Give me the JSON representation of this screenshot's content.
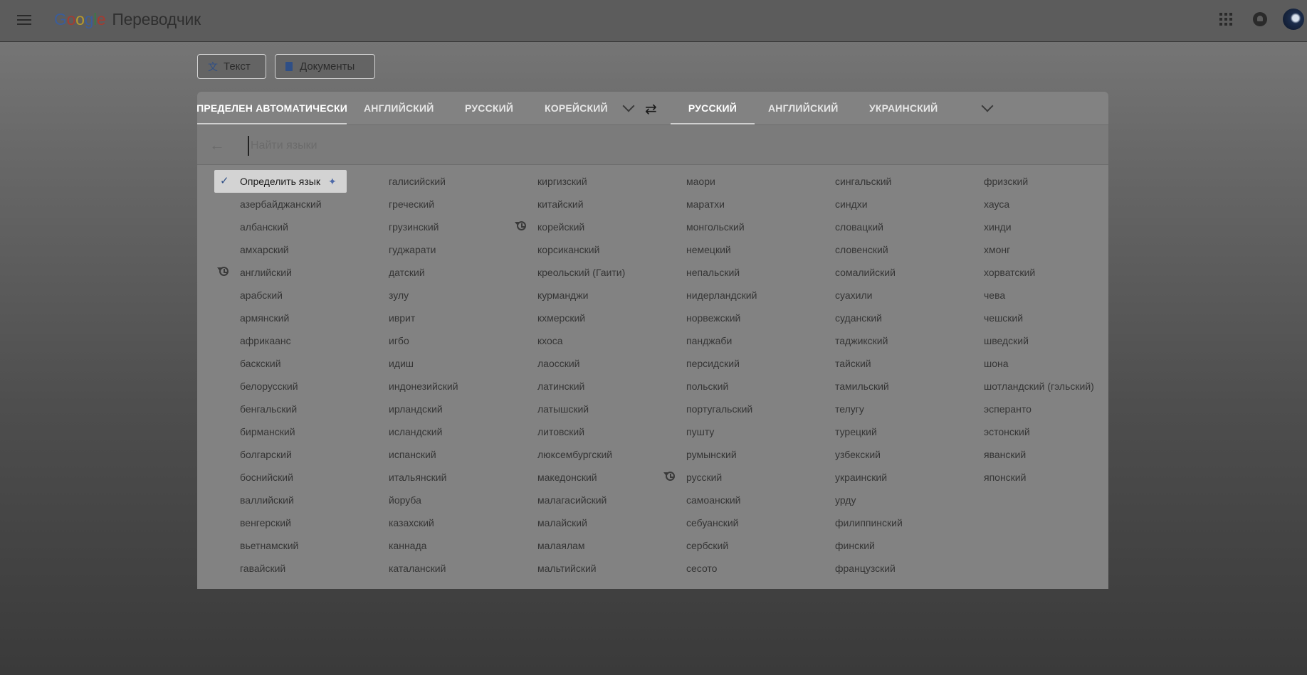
{
  "app": {
    "logo_letters": [
      "G",
      "o",
      "o",
      "g",
      "l",
      "e"
    ],
    "product_name": "Переводчик",
    "menu_icon": "menu-icon",
    "apps_icon": "apps-grid-icon",
    "bell_icon": "notifications-icon",
    "avatar_label": "account-avatar"
  },
  "modes": {
    "text_label": "Текст",
    "docs_label": "Документы"
  },
  "source_tabs": [
    {
      "label": "ОПРЕДЕЛЕН АВТОМАТИЧЕСКИ)",
      "active": true
    },
    {
      "label": "АНГЛИЙСКИЙ",
      "active": false
    },
    {
      "label": "РУССКИЙ",
      "active": false
    },
    {
      "label": "КОРЕЙСКИЙ",
      "active": false
    }
  ],
  "target_tabs": [
    {
      "label": "РУССКИЙ",
      "active": true
    },
    {
      "label": "АНГЛИЙСКИЙ",
      "active": false
    },
    {
      "label": "УКРАИНСКИЙ",
      "active": false
    }
  ],
  "search": {
    "placeholder": "Найти языки",
    "value": ""
  },
  "languages": {
    "col1": [
      "Определить язык",
      "азербайджанский",
      "албанский",
      "амхарский",
      "английский",
      "арабский",
      "армянский",
      "африкаанс",
      "баскский",
      "белорусский",
      "бенгальский",
      "бирманский",
      "болгарский",
      "боснийский",
      "валлийский",
      "венгерский",
      "вьетнамский",
      "гавайский"
    ],
    "col2": [
      "галисийский",
      "греческий",
      "грузинский",
      "гуджарати",
      "датский",
      "зулу",
      "иврит",
      "игбо",
      "идиш",
      "индонезийский",
      "ирландский",
      "исландский",
      "испанский",
      "итальянский",
      "йоруба",
      "казахский",
      "каннада",
      "каталанский"
    ],
    "col3": [
      "киргизский",
      "китайский",
      "корейский",
      "корсиканский",
      "креольский (Гаити)",
      "курманджи",
      "кхмерский",
      "кхоса",
      "лаосский",
      "латинский",
      "латышский",
      "литовский",
      "люксембургский",
      "македонский",
      "малагасийский",
      "малайский",
      "малаялам",
      "мальтийский"
    ],
    "col4": [
      "маори",
      "маратхи",
      "монгольский",
      "немецкий",
      "непальский",
      "нидерландский",
      "норвежский",
      "панджаби",
      "персидский",
      "польский",
      "португальский",
      "пушту",
      "румынский",
      "русский",
      "самоанский",
      "себуанский",
      "сербский",
      "сесото"
    ],
    "col5": [
      "сингальский",
      "синдхи",
      "словацкий",
      "словенский",
      "сомалийский",
      "суахили",
      "суданский",
      "таджикский",
      "тайский",
      "тамильский",
      "телугу",
      "турецкий",
      "узбекский",
      "украинский",
      "урду",
      "филиппинский",
      "финский",
      "французский"
    ],
    "col6": [
      "фризский",
      "хауса",
      "хинди",
      "хмонг",
      "хорватский",
      "чева",
      "чешский",
      "шведский",
      "шона",
      "шотландский (гэльский)",
      "эсперанто",
      "эстонский",
      "яванский",
      "японский"
    ]
  },
  "selected_language": "Определить язык",
  "recent_languages": [
    "английский",
    "корейский",
    "русский"
  ]
}
